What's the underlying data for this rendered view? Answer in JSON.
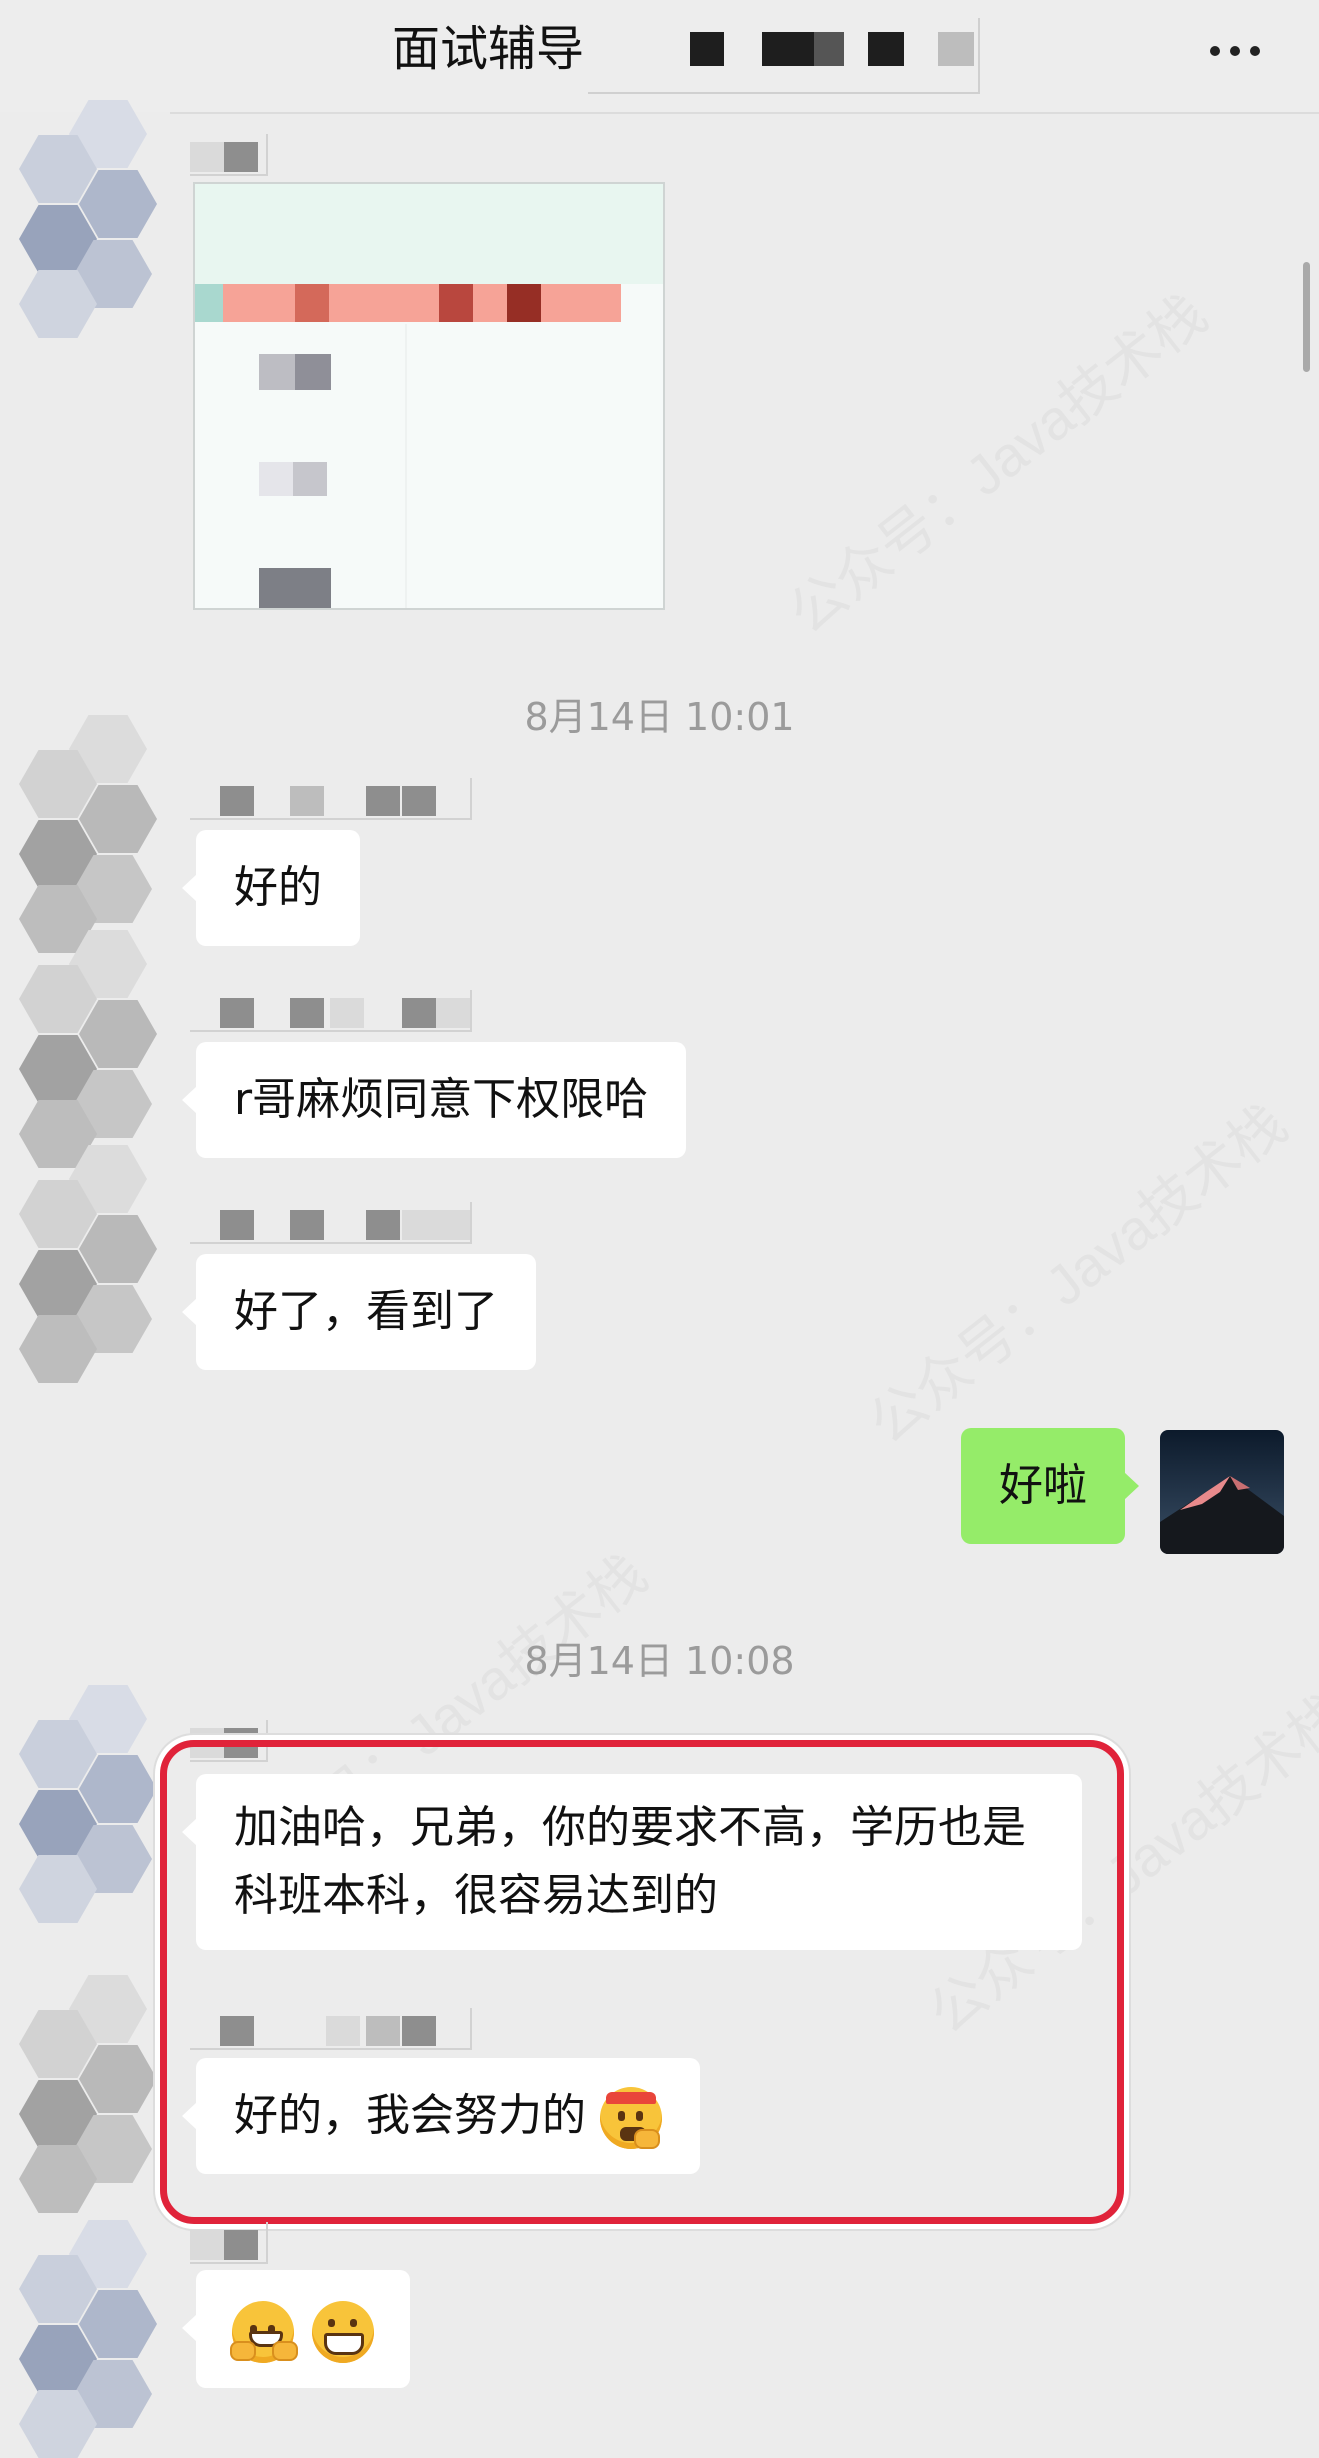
{
  "header": {
    "title": "面试辅导"
  },
  "timestamps": [
    "8月14日 10:01",
    "8月14日 10:08"
  ],
  "messages": [
    {
      "text": "好的"
    },
    {
      "text": "r哥麻烦同意下权限哈"
    },
    {
      "text": "好了，看到了"
    },
    {
      "text": "好啦"
    },
    {
      "text": "加油哈，兄弟，你的要求不高，学历也是科班本科，很容易达到的"
    },
    {
      "text": "好的，我会努力的"
    }
  ],
  "watermark": "公众号：Java技术栈",
  "icons": [
    "more-icon",
    "mountain-avatar",
    "working-hard-emoji",
    "hug-emoji",
    "grin-emoji"
  ],
  "colors": {
    "self_bubble": "#95ec69",
    "other_bubble": "#ffffff",
    "highlight": "#e0233a",
    "background": "#ececec"
  }
}
